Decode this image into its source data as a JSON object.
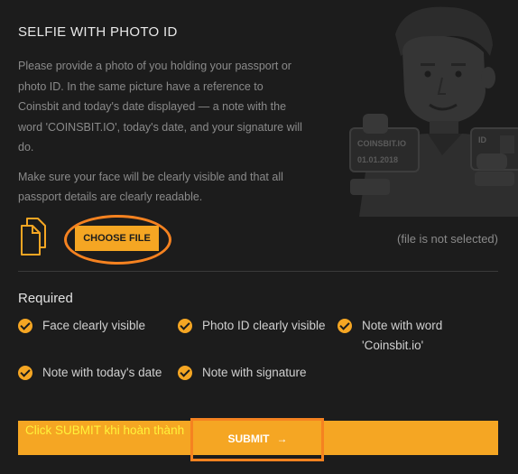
{
  "section": {
    "title": "SELFIE WITH PHOTO ID",
    "paragraph1": "Please provide a photo of you holding your passport or photo ID. In the same picture have a reference to Coinsbit and today's date displayed — a note with the word 'COINSBIT.IO', today's date, and your signature will do.",
    "paragraph2": "Make sure your face will be clearly visible and that all passport details are clearly readable."
  },
  "illustration": {
    "note_title": "COINSBIT.IO",
    "note_date": "01.01.2018",
    "id_card_label": "ID"
  },
  "upload": {
    "choose_file_label": "CHOOSE FILE",
    "file_status": "(file is not selected)"
  },
  "requirements": {
    "title": "Required",
    "items": [
      {
        "label": "Face clearly visible"
      },
      {
        "label": "Photo ID clearly visible"
      },
      {
        "label": "Note with word 'Coinsbit.io'"
      },
      {
        "label": "Note with today's date"
      },
      {
        "label": "Note with signature"
      }
    ]
  },
  "submit": {
    "hint": "Click SUBMIT khi hoàn thành",
    "label": "SUBMIT",
    "arrow": "→"
  },
  "colors": {
    "background": "#1c1c1c",
    "accent": "#f5a623",
    "annotation": "#f58220",
    "hint_text": "#fff23a"
  }
}
